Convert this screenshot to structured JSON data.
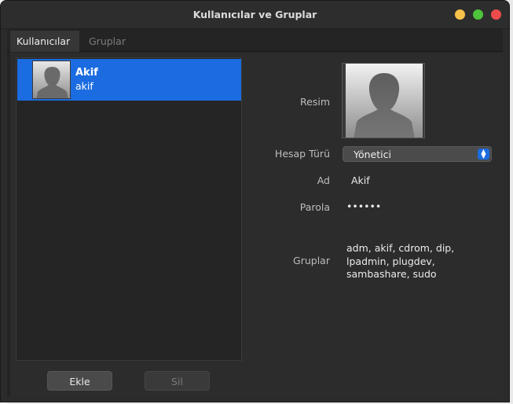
{
  "window": {
    "title": "Kullanıcılar ve Gruplar"
  },
  "tabs": [
    {
      "label": "Kullanıcılar",
      "active": true
    },
    {
      "label": "Gruplar",
      "active": false
    }
  ],
  "users": [
    {
      "name": "Akif",
      "login": "akif",
      "selected": true
    }
  ],
  "buttons": {
    "add": "Ekle",
    "remove": "Sil"
  },
  "details": {
    "picture_label": "Resim",
    "account_type_label": "Hesap Türü",
    "account_type_value": "Yönetici",
    "name_label": "Ad",
    "name_value": "Akif",
    "password_label": "Parola",
    "password_value": "••••••",
    "groups_label": "Gruplar",
    "groups_value": "adm, akif, cdrom, dip, lpadmin, plugdev, sambashare, sudo"
  },
  "colors": {
    "accent": "#1b6ce0",
    "window_bg": "#2c2c2c",
    "close": "#ee4b4b",
    "minimize": "#f6c24a",
    "maximize": "#4ec43b"
  },
  "icons": {
    "avatar": "person-silhouette-icon",
    "select_arrows": "chevron-up-down-icon"
  }
}
